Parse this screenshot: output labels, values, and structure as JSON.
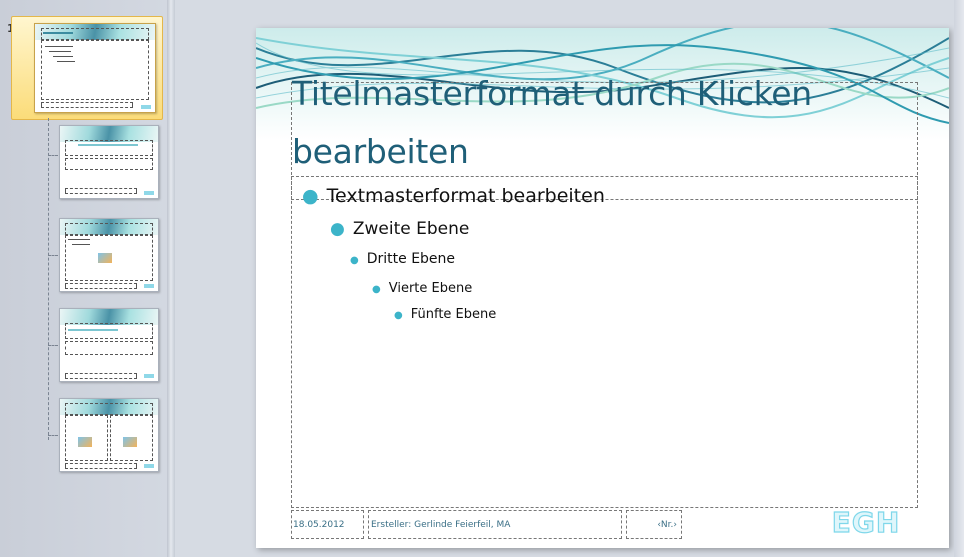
{
  "thumbnails": {
    "master_number": "1"
  },
  "slide": {
    "title": "Titelmasterformat durch Klicken bearbeiten",
    "levels": [
      "Textmasterformat bearbeiten",
      "Zweite Ebene",
      "Dritte Ebene",
      "Vierte Ebene",
      "Fünfte Ebene"
    ],
    "footer": {
      "date": "18.05.2012",
      "creator": "Ersteller: Gerlinde Feierfeil, MA",
      "number": "‹Nr.›"
    },
    "logo_text": "EGH"
  },
  "colors": {
    "title": "#1f5f78",
    "bullet": "#3cb4c9",
    "selection": "#fbdc79"
  }
}
